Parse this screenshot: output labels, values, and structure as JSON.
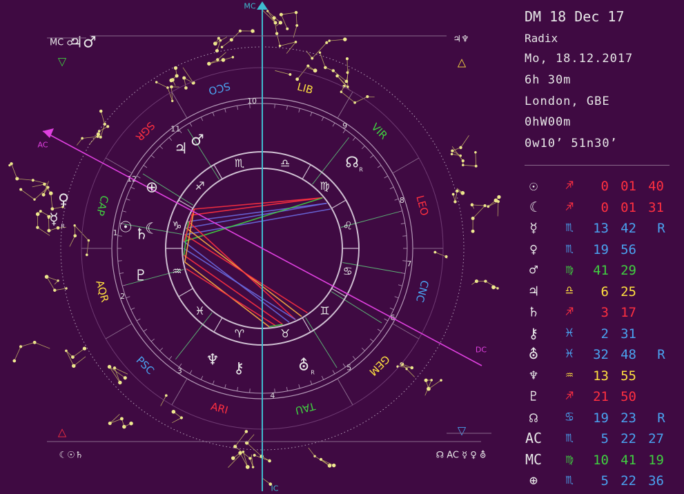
{
  "header": {
    "name": "DM 18 Dec 17",
    "chart_type": "Radix",
    "date": "Mo, 18.12.2017",
    "time": "6h 30m",
    "place": "London, GBE",
    "zone": "0hW00m",
    "coords": "0w10’  51n30’"
  },
  "colors": {
    "background": "#3f0a42",
    "fire": "#ff3040",
    "earth": "#40d040",
    "air": "#ffe040",
    "water": "#4aa3f0"
  },
  "signs": [
    {
      "abbr": "VIR",
      "glyph": "♍",
      "color": "#40d040"
    },
    {
      "abbr": "LEO",
      "glyph": "♌",
      "color": "#ff3040"
    },
    {
      "abbr": "CNC",
      "glyph": "♋",
      "color": "#4aa3f0"
    },
    {
      "abbr": "GEM",
      "glyph": "♊",
      "color": "#ffe040"
    },
    {
      "abbr": "TAU",
      "glyph": "♉",
      "color": "#40d040"
    },
    {
      "abbr": "ARI",
      "glyph": "♈",
      "color": "#ff3040"
    },
    {
      "abbr": "PSC",
      "glyph": "♓",
      "color": "#4aa3f0"
    },
    {
      "abbr": "AQR",
      "glyph": "♒",
      "color": "#ffe040"
    },
    {
      "abbr": "CAP",
      "glyph": "♑",
      "color": "#40d040"
    },
    {
      "abbr": "SGR",
      "glyph": "♐",
      "color": "#ff3040"
    },
    {
      "abbr": "SCO",
      "glyph": "♏",
      "color": "#4aa3f0"
    },
    {
      "abbr": "LIB",
      "glyph": "♎",
      "color": "#ffe040"
    }
  ],
  "houses": [
    "1",
    "2",
    "3",
    "4",
    "5",
    "6",
    "7",
    "8",
    "9",
    "10",
    "11",
    "12"
  ],
  "axes": {
    "mc": "MC",
    "ic": "IC",
    "ac": "AC",
    "dc": "DC"
  },
  "chart_planets": [
    {
      "glyph": "☉",
      "retro": ""
    },
    {
      "glyph": "☾",
      "retro": ""
    },
    {
      "glyph": "☿",
      "retro": "R"
    },
    {
      "glyph": "♀",
      "retro": ""
    },
    {
      "glyph": "♂",
      "retro": ""
    },
    {
      "glyph": "♃",
      "retro": ""
    },
    {
      "glyph": "♄",
      "retro": ""
    },
    {
      "glyph": "⚷",
      "retro": ""
    },
    {
      "glyph": "⛢",
      "retro": "R"
    },
    {
      "glyph": "♆",
      "retro": ""
    },
    {
      "glyph": "♇",
      "retro": ""
    },
    {
      "glyph": "☊",
      "retro": "R"
    },
    {
      "glyph": "♃♂",
      "retro": ""
    },
    {
      "glyph": "⊕",
      "retro": ""
    }
  ],
  "corners": {
    "top_left": {
      "text": "MC ♂",
      "glyph": "▽",
      "color": "#40d040"
    },
    "top_right": {
      "text": "♃♆",
      "glyph": "△",
      "color": "#ffe040"
    },
    "bottom_left": {
      "text": "☾☉♄",
      "glyph": "△",
      "color": "#ff3040"
    },
    "bottom_right": {
      "text": "☊ AC ☿ ♀ ⛢",
      "glyph": "▽",
      "color": "#4aa3f0"
    }
  },
  "planet_table": [
    {
      "glyph": "☉",
      "sign": "♐",
      "sign_color": "#ff3040",
      "v1": "0",
      "v2": "01",
      "v3": "40",
      "color": "#ff3040",
      "retro": ""
    },
    {
      "glyph": "☾",
      "sign": "♐",
      "sign_color": "#ff3040",
      "v1": "0",
      "v2": "01",
      "v3": "31",
      "color": "#ff3040",
      "retro": ""
    },
    {
      "glyph": "☿",
      "sign": "♏",
      "sign_color": "#4aa3f0",
      "v1": "13",
      "v2": "42",
      "v3": "",
      "color": "#4aa3f0",
      "retro": "R"
    },
    {
      "glyph": "♀",
      "sign": "♏",
      "sign_color": "#4aa3f0",
      "v1": "19",
      "v2": "56",
      "v3": "",
      "color": "#4aa3f0",
      "retro": ""
    },
    {
      "glyph": "♂",
      "sign": "♍",
      "sign_color": "#40d040",
      "v1": "41",
      "v2": "29",
      "v3": "",
      "color": "#40d040",
      "retro": ""
    },
    {
      "glyph": "♃",
      "sign": "♎",
      "sign_color": "#ffe040",
      "v1": "6",
      "v2": "25",
      "v3": "",
      "color": "#ffe040",
      "retro": ""
    },
    {
      "glyph": "♄",
      "sign": "♐",
      "sign_color": "#ff3040",
      "v1": "3",
      "v2": "17",
      "v3": "",
      "color": "#ff3040",
      "retro": ""
    },
    {
      "glyph": "⚷",
      "sign": "♓",
      "sign_color": "#4aa3f0",
      "v1": "2",
      "v2": "31",
      "v3": "",
      "color": "#4aa3f0",
      "retro": ""
    },
    {
      "glyph": "⛢",
      "sign": "♓",
      "sign_color": "#4aa3f0",
      "v1": "32",
      "v2": "48",
      "v3": "",
      "color": "#4aa3f0",
      "retro": "R"
    },
    {
      "glyph": "♆",
      "sign": "♒",
      "sign_color": "#ffe040",
      "v1": "13",
      "v2": "55",
      "v3": "",
      "color": "#ffe040",
      "retro": ""
    },
    {
      "glyph": "♇",
      "sign": "♐",
      "sign_color": "#ff3040",
      "v1": "21",
      "v2": "50",
      "v3": "",
      "color": "#ff3040",
      "retro": ""
    },
    {
      "glyph": "☊",
      "sign": "♋",
      "sign_color": "#4aa3f0",
      "v1": "19",
      "v2": "23",
      "v3": "",
      "color": "#4aa3f0",
      "retro": "R"
    },
    {
      "glyph": "AC",
      "sign": "♏",
      "sign_color": "#4aa3f0",
      "v1": "5",
      "v2": "22",
      "v3": "27",
      "color": "#4aa3f0",
      "retro": ""
    },
    {
      "glyph": "MC",
      "sign": "♍",
      "sign_color": "#40d040",
      "v1": "10",
      "v2": "41",
      "v3": "19",
      "color": "#40d040",
      "retro": ""
    },
    {
      "glyph": "⊕",
      "sign": "♏",
      "sign_color": "#4aa3f0",
      "v1": "5",
      "v2": "22",
      "v3": "36",
      "color": "#4aa3f0",
      "retro": ""
    }
  ]
}
